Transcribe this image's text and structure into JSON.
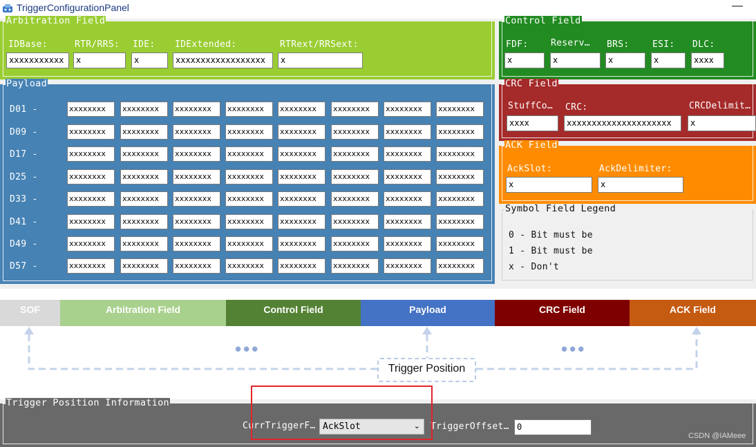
{
  "window": {
    "title": "TriggerConfigurationPanel",
    "minimize_glyph": "—",
    "icon": "app-icon"
  },
  "arbitration": {
    "legend": "Arbitration Field",
    "fields": [
      {
        "label": "IDBase:",
        "value": "xxxxxxxxxxx"
      },
      {
        "label": "RTR/RRS:",
        "value": "x"
      },
      {
        "label": "IDE:",
        "value": "x"
      },
      {
        "label": "IDExtended:",
        "value": "xxxxxxxxxxxxxxxxxx"
      },
      {
        "label": "RTRext/RRSext:",
        "value": "x"
      }
    ]
  },
  "control": {
    "legend": "Control Field",
    "fields": [
      {
        "label": "FDF:",
        "value": "x"
      },
      {
        "label": "Reserv…",
        "value": "x"
      },
      {
        "label": "BRS:",
        "value": "x"
      },
      {
        "label": "ESI:",
        "value": "x"
      },
      {
        "label": "DLC:",
        "value": "xxxx"
      }
    ]
  },
  "payload": {
    "legend": "Payload",
    "rows": [
      {
        "label": "D01 -",
        "cells": [
          "xxxxxxxx",
          "xxxxxxxx",
          "xxxxxxxx",
          "xxxxxxxx",
          "xxxxxxxx",
          "xxxxxxxx",
          "xxxxxxxx",
          "xxxxxxxx"
        ]
      },
      {
        "label": "D09 -",
        "cells": [
          "xxxxxxxx",
          "xxxxxxxx",
          "xxxxxxxx",
          "xxxxxxxx",
          "xxxxxxxx",
          "xxxxxxxx",
          "xxxxxxxx",
          "xxxxxxxx"
        ]
      },
      {
        "label": "D17 -",
        "cells": [
          "xxxxxxxx",
          "xxxxxxxx",
          "xxxxxxxx",
          "xxxxxxxx",
          "xxxxxxxx",
          "xxxxxxxx",
          "xxxxxxxx",
          "xxxxxxxx"
        ]
      },
      {
        "label": "D25 -",
        "cells": [
          "xxxxxxxx",
          "xxxxxxxx",
          "xxxxxxxx",
          "xxxxxxxx",
          "xxxxxxxx",
          "xxxxxxxx",
          "xxxxxxxx",
          "xxxxxxxx"
        ]
      },
      {
        "label": "D33 -",
        "cells": [
          "xxxxxxxx",
          "xxxxxxxx",
          "xxxxxxxx",
          "xxxxxxxx",
          "xxxxxxxx",
          "xxxxxxxx",
          "xxxxxxxx",
          "xxxxxxxx"
        ]
      },
      {
        "label": "D41 -",
        "cells": [
          "xxxxxxxx",
          "xxxxxxxx",
          "xxxxxxxx",
          "xxxxxxxx",
          "xxxxxxxx",
          "xxxxxxxx",
          "xxxxxxxx",
          "xxxxxxxx"
        ]
      },
      {
        "label": "D49 -",
        "cells": [
          "xxxxxxxx",
          "xxxxxxxx",
          "xxxxxxxx",
          "xxxxxxxx",
          "xxxxxxxx",
          "xxxxxxxx",
          "xxxxxxxx",
          "xxxxxxxx"
        ]
      },
      {
        "label": "D57 -",
        "cells": [
          "xxxxxxxx",
          "xxxxxxxx",
          "xxxxxxxx",
          "xxxxxxxx",
          "xxxxxxxx",
          "xxxxxxxx",
          "xxxxxxxx",
          "xxxxxxxx"
        ]
      }
    ]
  },
  "crc": {
    "legend": "CRC Field",
    "fields": [
      {
        "label": "StuffCo…",
        "value": "xxxx"
      },
      {
        "label": "CRC:",
        "value": "xxxxxxxxxxxxxxxxxxxxx"
      },
      {
        "label": "CRCDelimit…",
        "value": "x"
      }
    ]
  },
  "ack": {
    "legend": "ACK Field",
    "fields": [
      {
        "label": "AckSlot:",
        "value": "x"
      },
      {
        "label": "AckDelimiter:",
        "value": "x"
      }
    ]
  },
  "symbol_legend": {
    "legend": "Symbol Field Legend",
    "lines": [
      "0 - Bit must be",
      "1 - Bit must be",
      "x - Don't"
    ]
  },
  "frame_diagram": {
    "segments": [
      {
        "label": "SOF",
        "color": "#d9d9d9"
      },
      {
        "label": "Arbitration Field",
        "color": "#a9d18e"
      },
      {
        "label": "Control Field",
        "color": "#548235"
      },
      {
        "label": "Payload",
        "color": "#4472c4"
      },
      {
        "label": "CRC Field",
        "color": "#7f0000"
      },
      {
        "label": "ACK Field",
        "color": "#c55a11"
      }
    ],
    "ellipsis": "•••",
    "trigger_label": "Trigger Position"
  },
  "trigger_info": {
    "legend": "Trigger Position Information",
    "field_label": "CurrTriggerF…",
    "field_value": "AckSlot",
    "offset_label": "TriggerOffset…",
    "offset_value": "0"
  },
  "watermark": "CSDN @IAMeee"
}
